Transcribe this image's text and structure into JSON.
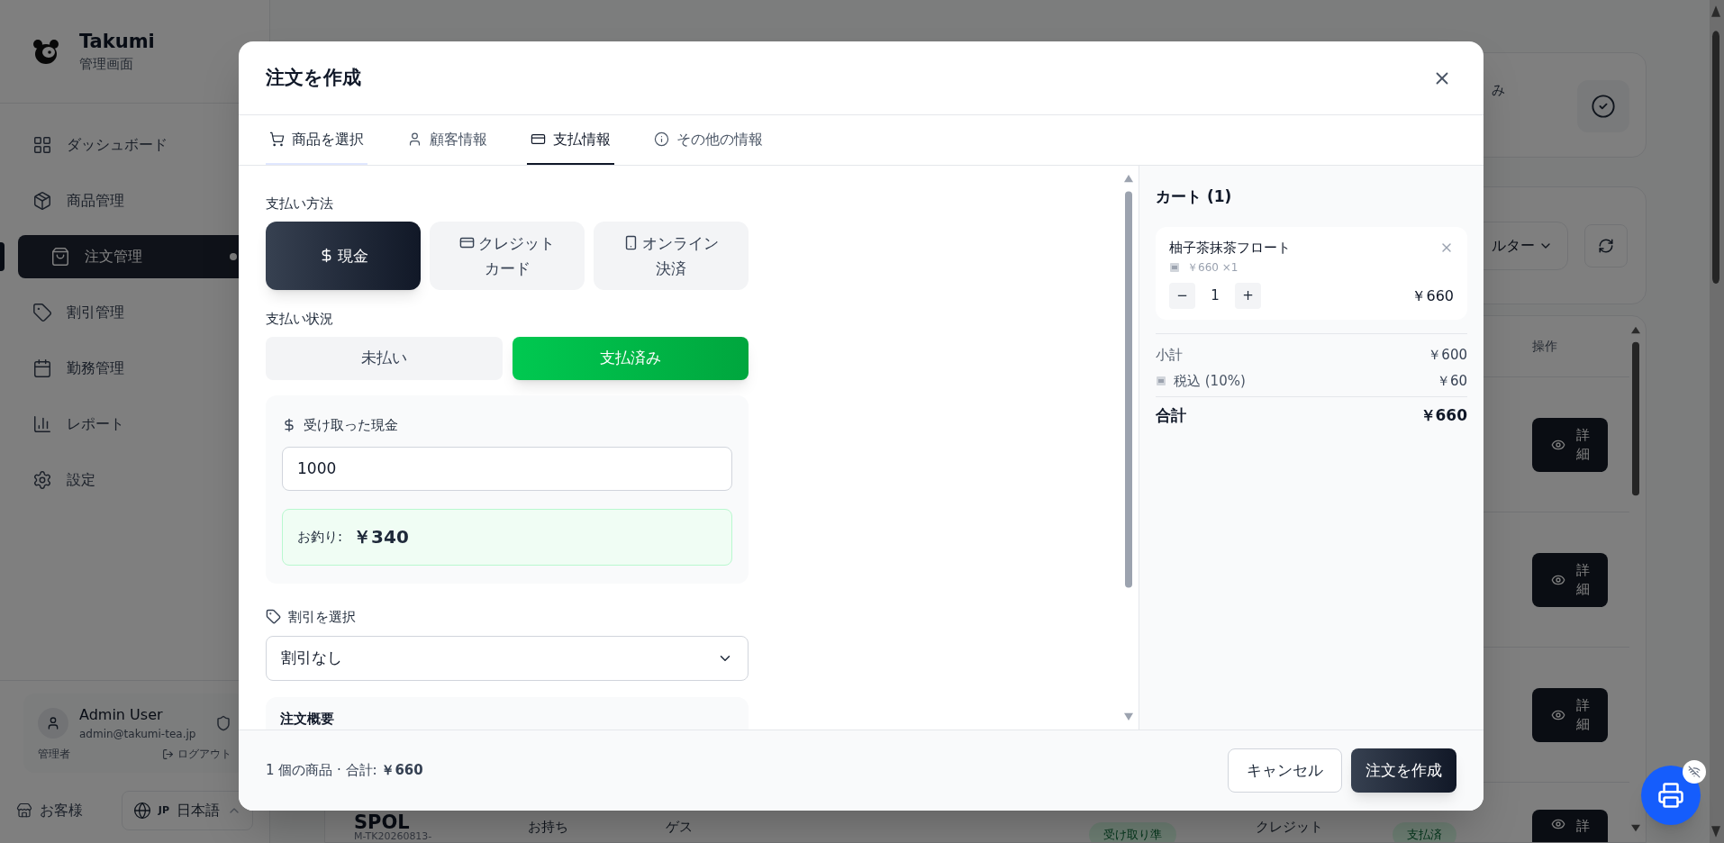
{
  "sidebar": {
    "brand": "Takumi",
    "subtitle": "管理画面",
    "items": [
      {
        "label": "ダッシュボード",
        "selected": false
      },
      {
        "label": "商品管理",
        "selected": false
      },
      {
        "label": "注文管理",
        "selected": true
      },
      {
        "label": "割引管理",
        "selected": false
      },
      {
        "label": "勤務管理",
        "selected": false
      },
      {
        "label": "レポート",
        "selected": false
      },
      {
        "label": "設定",
        "selected": false
      }
    ],
    "user": {
      "name": "Admin User",
      "email": "admin@takumi-tea.jp",
      "role": "管理者",
      "logout": "ログアウト"
    },
    "customer_link": "お客様",
    "language_code": "JP",
    "language": "日本語"
  },
  "background": {
    "card_text": "み",
    "filter": "ルター",
    "table_header": "操作",
    "detail_buttons": [
      "詳細",
      "詳細",
      "詳細",
      "詳"
    ],
    "last_row": {
      "name": "SPOL",
      "order_no": "M-TK20260813-",
      "type": "お持ち",
      "customer": "ゲス",
      "status": "受け取り準",
      "payment": "クレジット",
      "payment_status": "支払済"
    }
  },
  "modal": {
    "title": "注文を作成",
    "tabs": [
      {
        "label": "商品を選択",
        "selected": false,
        "done": true
      },
      {
        "label": "顧客情報",
        "selected": false,
        "done": false
      },
      {
        "label": "支払情報",
        "selected": true,
        "done": false
      },
      {
        "label": "その他の情報",
        "selected": false,
        "done": false
      }
    ],
    "payment_method": {
      "label": "支払い方法",
      "options": [
        {
          "label": "現金",
          "selected": true
        },
        {
          "label": "クレジットカード",
          "selected": false
        },
        {
          "label": "オンライン決済",
          "selected": false
        }
      ]
    },
    "payment_status": {
      "label": "支払い状況",
      "options": [
        {
          "label": "未払い",
          "selected": false
        },
        {
          "label": "支払済み",
          "selected": true
        }
      ]
    },
    "cash": {
      "label": "受け取った現金",
      "value": "1000",
      "change_label": "お釣り:",
      "change": "￥340"
    },
    "discount": {
      "label": "割引を選択",
      "value": "割引なし"
    },
    "summary_title": "注文概要",
    "cart": {
      "title": "カート (1)",
      "items": [
        {
          "name": "柚子茶抹茶フロート",
          "unit": "￥660 ×1",
          "qty": "1",
          "minus": "−",
          "plus": "+",
          "total": "￥660"
        }
      ],
      "subtotal_label": "小計",
      "subtotal": "￥600",
      "tax_label": "税込 (10%)",
      "tax": "￥60",
      "total_label": "合計",
      "total": "￥660"
    },
    "footer": {
      "summary": "1 個の商品 · 合計: **￥660**",
      "buttons": [
        {
          "label": "キャンセル",
          "kind": "secondary"
        },
        {
          "label": "注文を作成",
          "kind": "primary"
        }
      ]
    }
  }
}
